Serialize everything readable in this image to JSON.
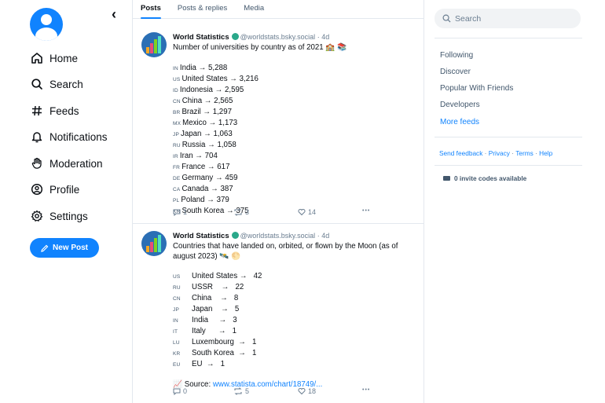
{
  "nav": {
    "items": [
      {
        "label": "Home",
        "icon": "home-icon"
      },
      {
        "label": "Search",
        "icon": "search-icon"
      },
      {
        "label": "Feeds",
        "icon": "hash-icon"
      },
      {
        "label": "Notifications",
        "icon": "bell-icon"
      },
      {
        "label": "Moderation",
        "icon": "hand-icon"
      },
      {
        "label": "Profile",
        "icon": "profile-icon"
      },
      {
        "label": "Settings",
        "icon": "gear-icon"
      }
    ],
    "new_post_label": "New Post",
    "back_glyph": "‹"
  },
  "tabs": [
    "Posts",
    "Posts & replies",
    "Media"
  ],
  "posts": [
    {
      "display_name": "World Statistics",
      "handle": "@worldstats.bsky.social",
      "time": "· 4d",
      "intro": "Number of universities by country as of 2021 🏫 📚",
      "lines": [
        {
          "cc": "IN",
          "text": "India → 5,288"
        },
        {
          "cc": "US",
          "text": "United States → 3,216"
        },
        {
          "cc": "ID",
          "text": "Indonesia → 2,595"
        },
        {
          "cc": "CN",
          "text": "China → 2,565"
        },
        {
          "cc": "BR",
          "text": "Brazil → 1,297"
        },
        {
          "cc": "MX",
          "text": "Mexico → 1,173"
        },
        {
          "cc": "JP",
          "text": "Japan → 1,063"
        },
        {
          "cc": "RU",
          "text": "Russia → 1,058"
        },
        {
          "cc": "IR",
          "text": "Iran → 704"
        },
        {
          "cc": "FR",
          "text": "France → 617"
        },
        {
          "cc": "DE",
          "text": "Germany → 459"
        },
        {
          "cc": "CA",
          "text": "Canada → 387"
        },
        {
          "cc": "PL",
          "text": "Poland → 379"
        },
        {
          "cc": "KR",
          "text": "South Korea → 375"
        }
      ],
      "replies": "1",
      "reposts": "3",
      "likes": "14",
      "more": "•••"
    },
    {
      "display_name": "World Statistics",
      "handle": "@worldstats.bsky.social",
      "time": "· 4d",
      "intro": "Countries that have landed on, orbited, or flown by the Moon (as of august 2023) 🛰️ 🌕",
      "lines": [
        {
          "cc": "US",
          "text": "United States →   42"
        },
        {
          "cc": "RU",
          "text": "USSR    →   22"
        },
        {
          "cc": "CN",
          "text": "China    →   8"
        },
        {
          "cc": "JP",
          "text": "Japan    →   5"
        },
        {
          "cc": "IN",
          "text": "India     →   3"
        },
        {
          "cc": "IT",
          "text": "Italy      →   1"
        },
        {
          "cc": "LU",
          "text": "Luxembourg  →   1"
        },
        {
          "cc": "KR",
          "text": "South Korea  →   1"
        },
        {
          "cc": "EU",
          "text": "EU  →   1"
        }
      ],
      "source_prefix": "📈 Source: ",
      "source_link": "www.statista.com/chart/18749/...",
      "replies": "0",
      "reposts": "5",
      "likes": "18",
      "more": "•••"
    }
  ],
  "right": {
    "search_placeholder": "Search",
    "feeds": [
      "Following",
      "Discover",
      "Popular With Friends",
      "Developers"
    ],
    "more_feeds": "More feeds",
    "footer": [
      "Send feedback",
      "Privacy",
      "Terms",
      "Help"
    ],
    "footer_sep": "·",
    "invite": "0 invite codes available"
  },
  "colors": {
    "accent": "#1083fe",
    "text": "#0b0f14",
    "muted": "#6a7d90",
    "border": "#e3e8ee"
  }
}
